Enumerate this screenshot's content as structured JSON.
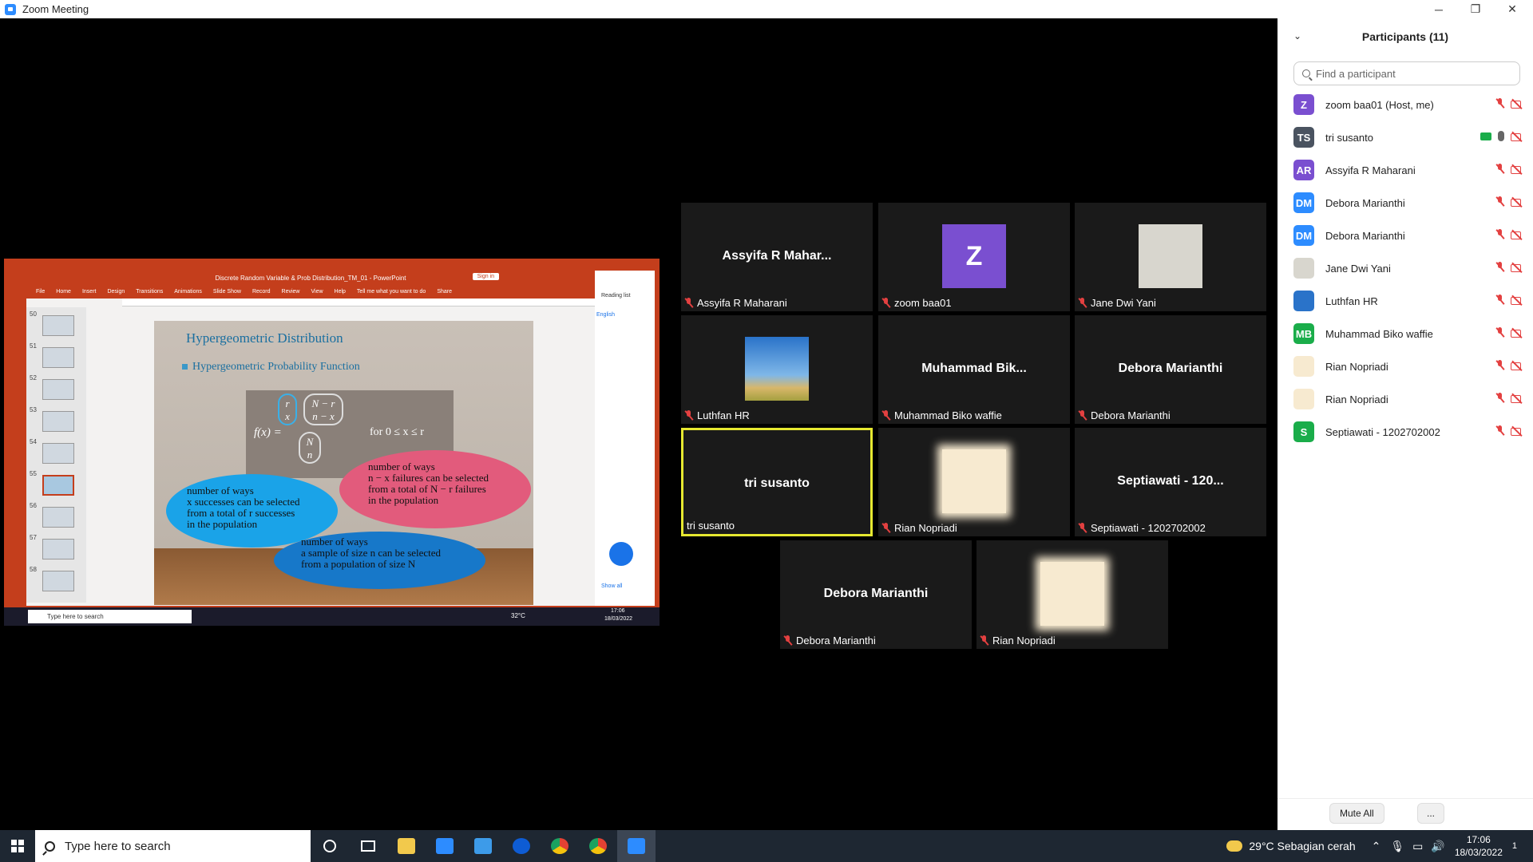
{
  "window": {
    "title": "Zoom Meeting",
    "controls": {
      "minimize": "─",
      "restore": "❐",
      "close": "✕"
    }
  },
  "share": {
    "ppt_title": "Discrete Random Variable & Prob Distribution_TM_01  -  PowerPoint",
    "signin": "Sign in",
    "ribbon_tabs": [
      "File",
      "Home",
      "Insert",
      "Design",
      "Transitions",
      "Animations",
      "Slide Show",
      "Record",
      "Review",
      "View",
      "Help",
      "Tell me what you want to do",
      "Share"
    ],
    "slide_numbers": [
      "50",
      "51",
      "52",
      "53",
      "54",
      "55",
      "56",
      "57",
      "58"
    ],
    "active_slide": "55",
    "slide_title": "Hypergeometric Distribution",
    "slide_subtitle": "Hypergeometric Probability Function",
    "formula_lhs": "f(x) =",
    "binom1": [
      "r",
      "x"
    ],
    "binom2": [
      "N − r",
      "n − x"
    ],
    "binom3": [
      "N",
      "n"
    ],
    "formula_range": "for  0 ≤ x ≤ r",
    "ellipse_blue": [
      "number of ways",
      "x successes can be selected",
      "from a total of r successes",
      "in the population"
    ],
    "ellipse_pink": [
      "number of ways",
      "n − x failures can be selected",
      "from a total of N − r failures",
      "in the population"
    ],
    "ellipse_blue2": [
      "number of ways",
      "a sample of size n can be selected",
      "from a population of size N"
    ],
    "side_panel_lang": "English",
    "side_panel_reading": "Reading list",
    "side_panel_showall": "Show all",
    "inner_search": "Type here to search",
    "inner_temp": "32°C",
    "inner_time": "17:06",
    "inner_date": "18/03/2022"
  },
  "tiles": [
    {
      "name": "Assyifa R Maharani",
      "big": "Assyifa R Mahar...",
      "muted": true,
      "type": "name"
    },
    {
      "name": "zoom baa01",
      "avatar": "Z",
      "muted": true,
      "type": "avatar"
    },
    {
      "name": "Jane Dwi Yani",
      "muted": true,
      "type": "fog"
    },
    {
      "name": "Luthfan HR",
      "muted": true,
      "type": "sky"
    },
    {
      "name": "Muhammad Biko waffie",
      "big": "Muhammad  Bik...",
      "muted": true,
      "type": "name"
    },
    {
      "name": "Debora Marianthi",
      "big": "Debora Marianthi",
      "muted": true,
      "type": "name"
    },
    {
      "name": "tri susanto",
      "big": "tri susanto",
      "muted": false,
      "type": "name",
      "speaking": true
    },
    {
      "name": "Rian Nopriadi",
      "muted": true,
      "type": "cream"
    },
    {
      "name": "Septiawati - 1202702002",
      "big": "Septiawati - 120...",
      "muted": true,
      "type": "name"
    },
    {
      "name": "Debora Marianthi",
      "big": "Debora Marianthi",
      "muted": true,
      "type": "name"
    },
    {
      "name": "Rian Nopriadi",
      "muted": true,
      "type": "cream"
    }
  ],
  "panel": {
    "title": "Participants (11)",
    "search_placeholder": "Find a participant",
    "participants": [
      {
        "initials": "Z",
        "name": "zoom baa01 (Host, me)",
        "color": "#7a4fd0"
      },
      {
        "initials": "TS",
        "name": "tri susanto",
        "color": "#4a5360",
        "sharing": true,
        "mic_on": true
      },
      {
        "initials": "AR",
        "name": "Assyifa R Maharani",
        "color": "#7a4fd0"
      },
      {
        "initials": "DM",
        "name": "Debora Marianthi",
        "color": "#2d8cff"
      },
      {
        "initials": "DM",
        "name": "Debora Marianthi",
        "color": "#2d8cff"
      },
      {
        "initials": "",
        "name": "Jane Dwi Yani",
        "color": "#d8d6ce"
      },
      {
        "initials": "",
        "name": "Luthfan HR",
        "color": "#2a73c9"
      },
      {
        "initials": "MB",
        "name": "Muhammad Biko waffie",
        "color": "#1aad4a"
      },
      {
        "initials": "",
        "name": "Rian Nopriadi",
        "color": "#f7ead0"
      },
      {
        "initials": "",
        "name": "Rian Nopriadi",
        "color": "#f7ead0"
      },
      {
        "initials": "S",
        "name": "Septiawati - 1202702002",
        "color": "#1aad4a"
      }
    ],
    "mute_all": "Mute All",
    "more": "..."
  },
  "taskbar": {
    "search_text": "Type here to search",
    "weather": "29°C  Sebagian cerah",
    "time": "17:06",
    "date": "18/03/2022",
    "notifications": "1"
  }
}
